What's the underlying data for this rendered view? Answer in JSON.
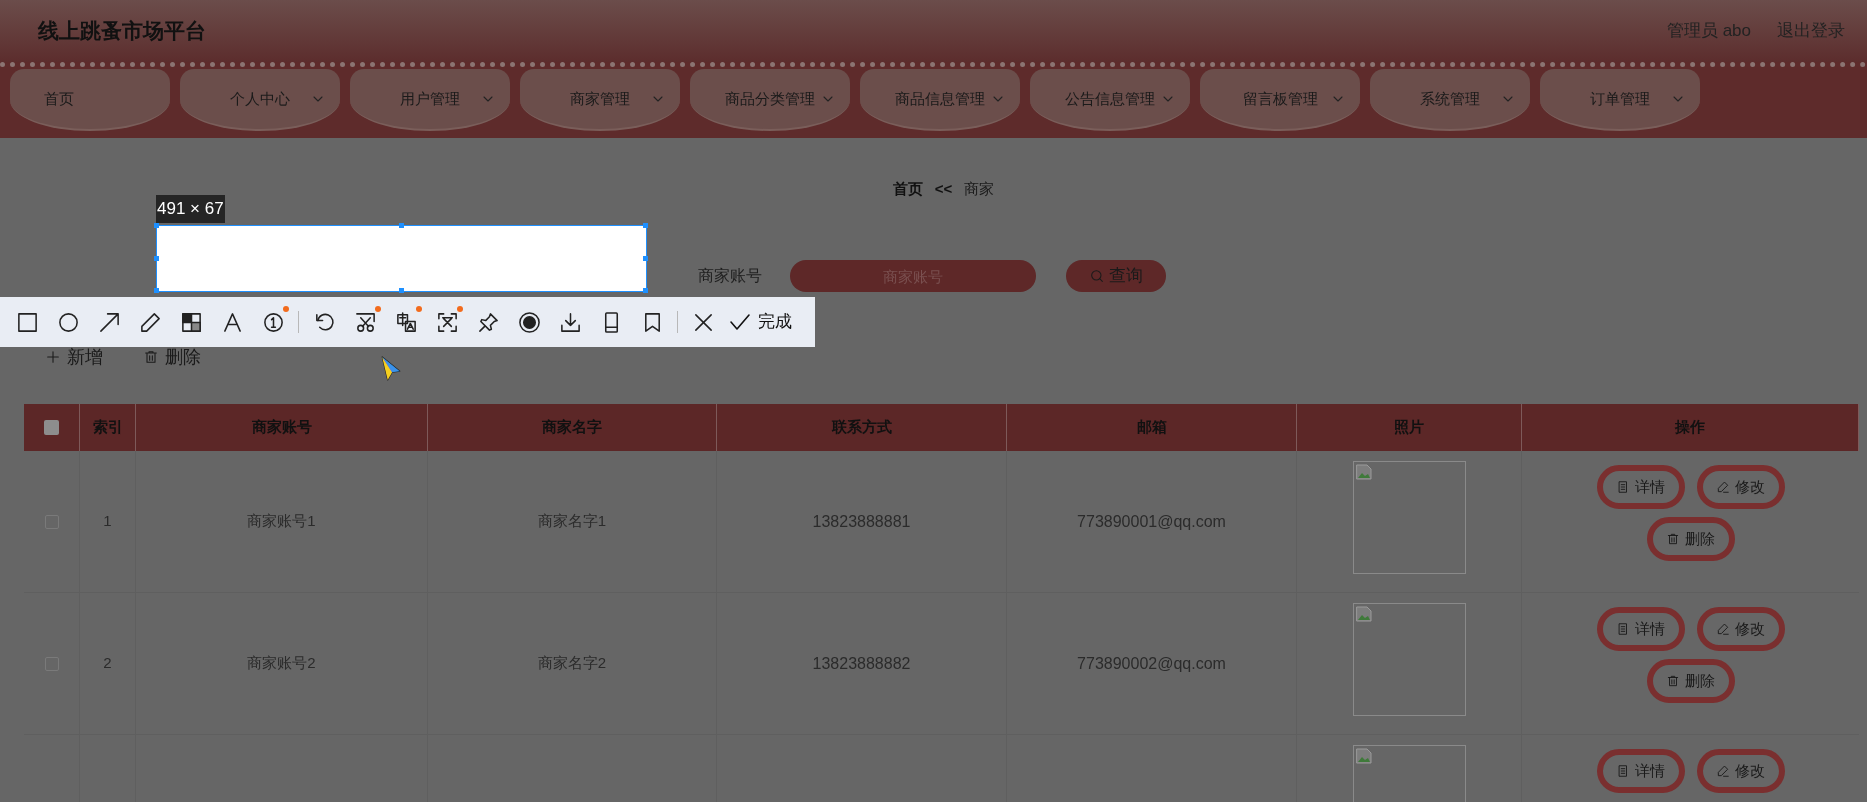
{
  "header": {
    "title": "线上跳蚤市场平台",
    "user": "管理员 abo",
    "logout": "退出登录"
  },
  "nav": [
    {
      "label": "首页",
      "has_menu": false
    },
    {
      "label": "个人中心",
      "has_menu": true
    },
    {
      "label": "用户管理",
      "has_menu": true
    },
    {
      "label": "商家管理",
      "has_menu": true
    },
    {
      "label": "商品分类管理",
      "has_menu": true
    },
    {
      "label": "商品信息管理",
      "has_menu": true
    },
    {
      "label": "公告信息管理",
      "has_menu": true
    },
    {
      "label": "留言板管理",
      "has_menu": true
    },
    {
      "label": "系统管理",
      "has_menu": true
    },
    {
      "label": "订单管理",
      "has_menu": true
    }
  ],
  "breadcrumb": {
    "home": "首页",
    "separator": "<<",
    "current": "商家"
  },
  "search": {
    "label": "商家账号",
    "placeholder": "商家账号",
    "button": "查询"
  },
  "actions": [
    {
      "kind": "add",
      "label": "新增"
    },
    {
      "kind": "delete",
      "label": "删除"
    }
  ],
  "table": {
    "select_all": {
      "checked": false
    },
    "columns": [
      "索引",
      "商家账号",
      "商家名字",
      "联系方式",
      "邮箱",
      "照片",
      "操作"
    ],
    "rows": [
      {
        "checked": false,
        "index": "1",
        "account": "商家账号1",
        "name": "商家名字1",
        "phone": "13823888881",
        "email": "773890001@qq.com",
        "photo": {
          "kind": "broken"
        },
        "actions": [
          {
            "kind": "detail",
            "label": "详情"
          },
          {
            "kind": "edit",
            "label": "修改"
          },
          {
            "kind": "delete",
            "label": "删除"
          }
        ]
      },
      {
        "checked": false,
        "index": "2",
        "account": "商家账号2",
        "name": "商家名字2",
        "phone": "13823888882",
        "email": "773890002@qq.com",
        "photo": {
          "kind": "broken"
        },
        "actions": [
          {
            "kind": "detail",
            "label": "详情"
          },
          {
            "kind": "edit",
            "label": "修改"
          },
          {
            "kind": "delete",
            "label": "删除"
          }
        ]
      },
      {
        "photo": {
          "kind": "broken"
        },
        "actions": [
          {
            "kind": "detail",
            "label": "详情"
          },
          {
            "kind": "edit",
            "label": "修改"
          }
        ]
      }
    ]
  },
  "capture": {
    "size": "491 × 67",
    "tools": [
      {
        "kind": "rect",
        "dot": false
      },
      {
        "kind": "ellipse",
        "dot": false
      },
      {
        "kind": "arrow",
        "dot": false
      },
      {
        "kind": "pencil",
        "dot": false
      },
      {
        "kind": "mosaic",
        "dot": false
      },
      {
        "kind": "text",
        "dot": false
      },
      {
        "kind": "number",
        "dot": true
      },
      {
        "kind": "divider"
      },
      {
        "kind": "undo",
        "dot": false
      },
      {
        "kind": "cut",
        "dot": true
      },
      {
        "kind": "translate",
        "dot": true
      },
      {
        "kind": "ocr",
        "dot": true
      },
      {
        "kind": "pin",
        "dot": false
      },
      {
        "kind": "record",
        "dot": false
      },
      {
        "kind": "download",
        "dot": false
      },
      {
        "kind": "phone",
        "dot": false
      },
      {
        "kind": "bookmark",
        "dot": false
      },
      {
        "kind": "divider"
      },
      {
        "kind": "close",
        "dot": false
      },
      {
        "kind": "done",
        "label": "完成"
      }
    ]
  }
}
